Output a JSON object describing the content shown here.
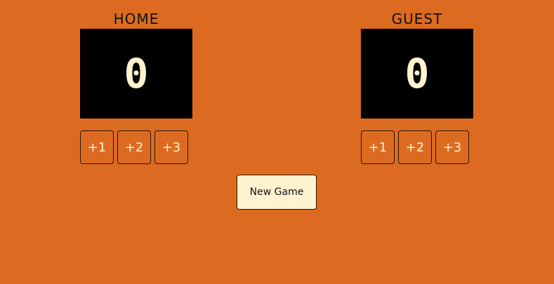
{
  "colors": {
    "background": "#DC6B21",
    "score_panel": "#000000",
    "score_text": "#FFF3CF",
    "new_game_button": "#FFF3CF"
  },
  "home": {
    "label": "HOME",
    "score": "0",
    "buttons": [
      "+1",
      "+2",
      "+3"
    ]
  },
  "guest": {
    "label": "GUEST",
    "score": "0",
    "buttons": [
      "+1",
      "+2",
      "+3"
    ]
  },
  "new_game_label": "New Game"
}
